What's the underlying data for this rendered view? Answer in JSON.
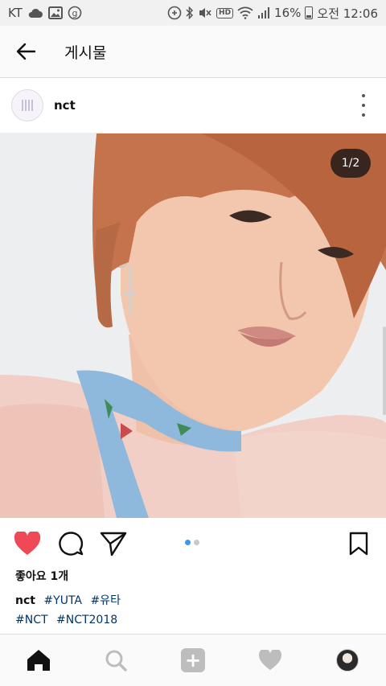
{
  "status_bar": {
    "carrier": "KT",
    "battery_percent": "16%",
    "time": "오전 12:06",
    "icons": [
      "cloud-icon",
      "gallery-icon",
      "g-icon",
      "sync-icon",
      "bluetooth-icon",
      "mute-icon",
      "hd-icon",
      "wifi-icon",
      "signal-icon",
      "battery-icon"
    ],
    "hd_label": "HD"
  },
  "header": {
    "title": "게시물"
  },
  "post": {
    "username": "nct",
    "page_indicator": "1/2",
    "photo_alt_colors": [
      "#e9ecef",
      "#f3cfc5",
      "#8ab4d8",
      "#c5734d"
    ],
    "carousel_dots": 2,
    "active_dot": 0,
    "likes": "좋아요 1개",
    "caption": {
      "user": "nct",
      "line1_tags": [
        "#YUTA",
        "#유타"
      ],
      "line2_tags": [
        "#NCT",
        "#NCT2018"
      ]
    }
  },
  "actions": {
    "like_color": "#ed4956",
    "dot_active_color": "#3897f0"
  },
  "bottom_nav": [
    "home-icon",
    "search-icon",
    "add-icon",
    "heart-icon",
    "profile-avatar"
  ]
}
